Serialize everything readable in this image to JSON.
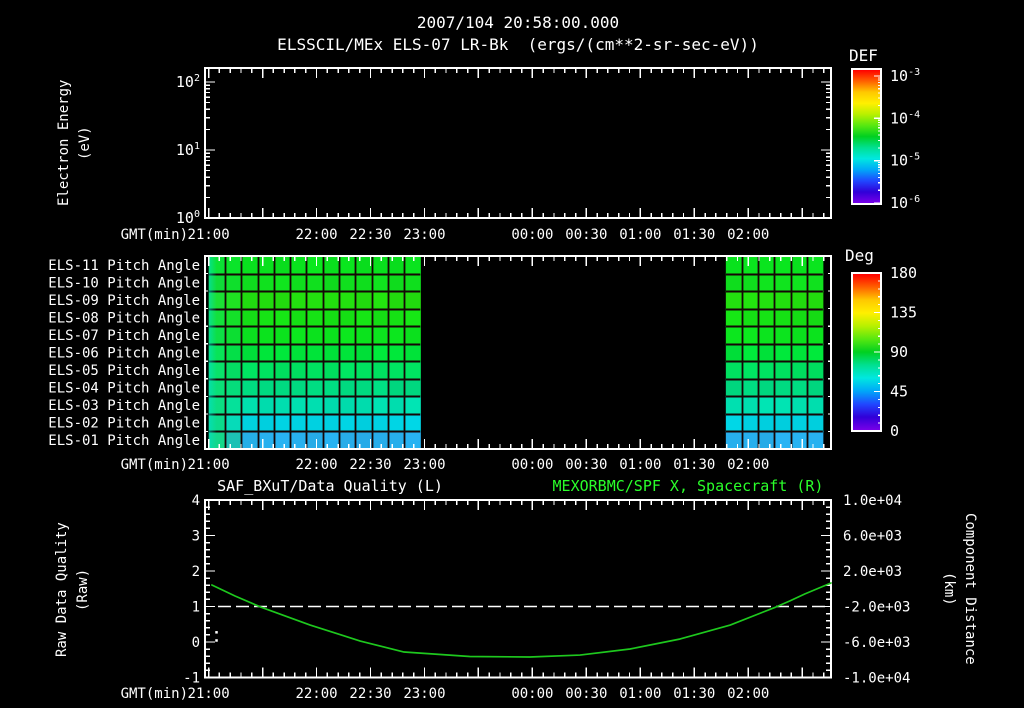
{
  "header": {
    "date_line": "2007/104 20:58:00.000",
    "title_line": "ELSSCIL/MEx ELS-07 LR-Bk  (ergs/(cm**2-sr-sec-eV))"
  },
  "labels": {
    "gmt": "GMT(min)",
    "energy_l1": "Electron Energy",
    "energy_l2": "(eV)",
    "quality_l1": "Raw Data Quality",
    "quality_l2": "(Raw)",
    "dist_l1": "Component Distance",
    "dist_l2": "(km)",
    "def": "DEF",
    "deg": "Deg",
    "bottom_left_title": "SAF_BXuT/Data Quality (L)",
    "bottom_right_title": "MEXORBMC/SPF X, Spacecraft (R)"
  },
  "colors": {
    "background": "#000000",
    "frame": "#ffffff",
    "curve_green": "#1ec81e",
    "title_green": "#2aff2a",
    "grid_dark": "#160606",
    "rainbow": [
      "#ff0000",
      "#ff6000",
      "#ffc800",
      "#fff000",
      "#b8f000",
      "#58e810",
      "#00d020",
      "#00e090",
      "#00e8e0",
      "#00a8f8",
      "#2048ff",
      "#3000d8",
      "#7800e8"
    ]
  },
  "time_axis": {
    "label": "GMT(min)",
    "start": "20:58",
    "span_min": 348,
    "minor_step": 6,
    "major_step": 30,
    "ticks": [
      {
        "m": 2,
        "label": "21:00"
      },
      {
        "m": 62,
        "label": "22:00"
      },
      {
        "m": 92,
        "label": "22:30"
      },
      {
        "m": 122,
        "label": "23:00"
      },
      {
        "m": 182,
        "label": "00:00"
      },
      {
        "m": 212,
        "label": "00:30"
      },
      {
        "m": 242,
        "label": "01:00"
      },
      {
        "m": 272,
        "label": "01:30"
      },
      {
        "m": 302,
        "label": "02:00"
      }
    ]
  },
  "chart_data": [
    {
      "type": "heatmap",
      "name": "electron-energy-spectrogram",
      "title": "ELSSCIL/MEx ELS-07 LR-Bk",
      "units": "ergs/(cm**2-sr-sec-eV)",
      "y_axis": {
        "label": "Electron Energy (eV)",
        "scale": "log",
        "min": 1,
        "max": 160,
        "ticks": [
          {
            "m": "10",
            "e": "2",
            "value": 100
          },
          {
            "m": "10",
            "e": "1",
            "value": 10
          },
          {
            "m": "10",
            "e": "0",
            "value": 1
          }
        ]
      },
      "colorbar": {
        "title": "DEF",
        "scale": "log",
        "ticks": [
          {
            "m": "10",
            "e": "-3"
          },
          {
            "m": "10",
            "e": "-4"
          },
          {
            "m": "10",
            "e": "-5"
          },
          {
            "m": "10",
            "e": "-6"
          }
        ]
      },
      "segments": [
        {
          "start": "20:58",
          "end": "22:57",
          "f0": 0.006,
          "f1": 0.344
        },
        {
          "start": "01:48",
          "end": "02:45",
          "f0": 0.832,
          "f1": 0.995
        }
      ],
      "profile": [
        [
          0.0,
          "#140a50",
          0.55
        ],
        [
          0.06,
          "#1c14a0",
          0.4
        ],
        [
          0.13,
          "#2020cc",
          0.32
        ],
        [
          0.22,
          "#2228dc",
          0.32
        ],
        [
          0.3,
          "#1060e0",
          0.35
        ],
        [
          0.36,
          "#00b8c8",
          0.3
        ],
        [
          0.42,
          "#10d878",
          0.28
        ],
        [
          0.47,
          "#38e022",
          0.24
        ],
        [
          0.53,
          "#40e418",
          0.24
        ],
        [
          0.58,
          "#20dc50",
          0.28
        ],
        [
          0.63,
          "#00d496",
          0.3
        ],
        [
          0.69,
          "#00c0cc",
          0.34
        ],
        [
          0.74,
          "#1888e0",
          0.36
        ],
        [
          0.79,
          "#2430c0",
          0.42
        ],
        [
          0.85,
          "#281890",
          0.5
        ],
        [
          0.93,
          "#200c60",
          0.55
        ],
        [
          1.0,
          "#180848",
          0.6
        ]
      ],
      "features": {
        "yellow_blob": {
          "segment": 0,
          "col_extent": 0.28,
          "center_f": 0.5,
          "sigma": 0.085
        },
        "rising_wisp": {
          "segment": 1,
          "col_start": 0.88,
          "center_from": 0.44,
          "center_to": 0.1,
          "sigma": 0.07
        }
      }
    },
    {
      "type": "heatmap",
      "name": "pitch-angle-panel",
      "colorbar": {
        "title": "Deg",
        "min": 0,
        "max": 180,
        "ticks": [
          "180",
          "135",
          "90",
          "45",
          "0"
        ],
        "tick_values": [
          180,
          135,
          90,
          45,
          0
        ]
      },
      "rows": [
        {
          "label": "ELS-11 Pitch Angle",
          "deg": 105,
          "color": "#0ae41e"
        },
        {
          "label": "ELS-10 Pitch Angle",
          "deg": 104,
          "color": "#10e01e"
        },
        {
          "label": "ELS-09 Pitch Angle",
          "deg": 108,
          "color": "#23e00f"
        },
        {
          "label": "ELS-08 Pitch Angle",
          "deg": 106,
          "color": "#16e215"
        },
        {
          "label": "ELS-07 Pitch Angle",
          "deg": 105,
          "color": "#0ce41e"
        },
        {
          "label": "ELS-06 Pitch Angle",
          "deg": 100,
          "color": "#00e53a"
        },
        {
          "label": "ELS-05 Pitch Angle",
          "deg": 95,
          "color": "#00e160"
        },
        {
          "label": "ELS-04 Pitch Angle",
          "deg": 90,
          "color": "#00dc82"
        },
        {
          "label": "ELS-03 Pitch Angle",
          "deg": 77,
          "color": "#00e2b2"
        },
        {
          "label": "ELS-02 Pitch Angle",
          "deg": 63,
          "color": "#00d2e2"
        },
        {
          "label": "ELS-01 Pitch Angle",
          "deg": 50,
          "color": "#28b0ee"
        }
      ],
      "entry_color": "#10e070",
      "segments": [
        {
          "start": "20:58",
          "end": "22:57",
          "f0": 0.006,
          "f1": 0.344,
          "cols": 13
        },
        {
          "start": "01:48",
          "end": "02:44",
          "f0": 0.832,
          "f1": 0.987,
          "cols": 6
        }
      ]
    },
    {
      "type": "line",
      "name": "quality-and-distance",
      "left_axis": {
        "label": "Raw Data Quality (Raw)",
        "min": -1,
        "max": 4,
        "ticks": [
          "4",
          "3",
          "2",
          "1",
          "0",
          "-1"
        ],
        "tick_values": [
          4,
          3,
          2,
          1,
          0,
          -1
        ],
        "minor_step": 0.2
      },
      "right_axis": {
        "label": "Component Distance (km)",
        "min": -10000,
        "max": 10000,
        "ticks": [
          "1.0e+04",
          "6.0e+03",
          "2.0e+03",
          "-2.0e+03",
          "-6.0e+03",
          "-1.0e+04"
        ],
        "tick_values": [
          10000,
          6000,
          2000,
          -2000,
          -6000,
          -10000
        ]
      },
      "series": [
        {
          "name": "SAF_BXuT/Data Quality (L)",
          "axis": "left",
          "color": "#ffffff",
          "style": "dashed",
          "constant_value": 1.0,
          "points": [
            {
              "f": 0.018,
              "v": 0.28
            },
            {
              "f": 0.018,
              "v": 0.05
            }
          ]
        },
        {
          "name": "MEXORBMC/SPF X, Spacecraft (R)",
          "axis": "right",
          "color": "#1ec81e",
          "style": "solid",
          "points_f_km": [
            [
              0.011,
              420
            ],
            [
              0.048,
              -820
            ],
            [
              0.089,
              -2060
            ],
            [
              0.168,
              -4090
            ],
            [
              0.248,
              -5890
            ],
            [
              0.318,
              -7130
            ],
            [
              0.423,
              -7630
            ],
            [
              0.519,
              -7690
            ],
            [
              0.599,
              -7470
            ],
            [
              0.679,
              -6790
            ],
            [
              0.759,
              -5660
            ],
            [
              0.839,
              -4090
            ],
            [
              0.912,
              -2060
            ],
            [
              0.934,
              -1380
            ],
            [
              0.958,
              -590
            ],
            [
              1.0,
              650
            ]
          ]
        }
      ]
    }
  ]
}
